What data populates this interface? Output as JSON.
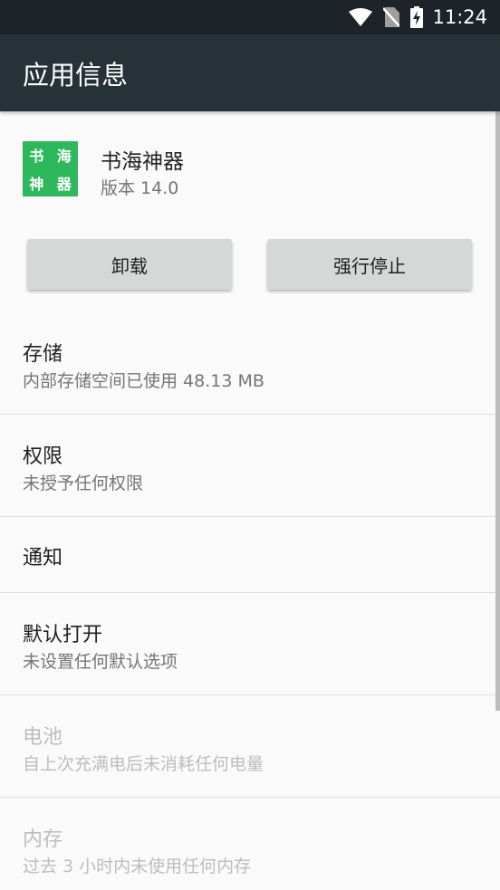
{
  "status_bar": {
    "time": "11:24",
    "icons": [
      "wifi-icon",
      "no-sim-icon",
      "battery-charging-icon"
    ]
  },
  "app_bar": {
    "title": "应用信息"
  },
  "app": {
    "icon_chars": [
      "书",
      "海",
      "神",
      "器"
    ],
    "icon_color": "#2eb85c",
    "name": "书海神器",
    "version": "版本 14.0"
  },
  "buttons": {
    "uninstall": "卸载",
    "force_stop": "强行停止"
  },
  "settings": [
    {
      "title": "存储",
      "summary": "内部存储空间已使用 48.13 MB",
      "enabled": true
    },
    {
      "title": "权限",
      "summary": "未授予任何权限",
      "enabled": true
    },
    {
      "title": "通知",
      "summary": "",
      "enabled": true
    },
    {
      "title": "默认打开",
      "summary": "未设置任何默认选项",
      "enabled": true
    },
    {
      "title": "电池",
      "summary": "自上次充满电后未消耗任何电量",
      "enabled": false
    },
    {
      "title": "内存",
      "summary": "过去 3 小时内未使用任何内存",
      "enabled": false
    }
  ]
}
